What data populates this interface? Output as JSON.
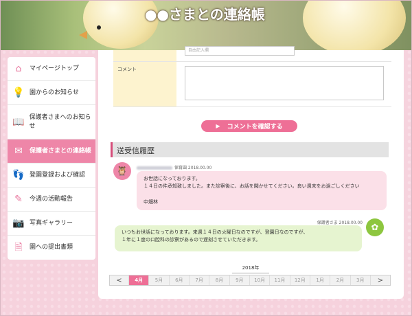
{
  "header": {
    "title": "●●さまとの連絡帳"
  },
  "sidebar": {
    "items": [
      {
        "label": "マイページトップ",
        "icon": "house-icon"
      },
      {
        "label": "園からのお知らせ",
        "icon": "lightbulb-icon"
      },
      {
        "label": "保護者さまへのお知らせ",
        "icon": "book-icon"
      },
      {
        "label": "保護者さまとの連絡帳",
        "icon": "envelope-icon",
        "active": true
      },
      {
        "label": "登園登録および確認",
        "icon": "footprints-icon"
      },
      {
        "label": "今週の活動報告",
        "icon": "pencil-icon"
      },
      {
        "label": "写真ギャラリー",
        "icon": "camera-icon"
      },
      {
        "label": "園への提出書類",
        "icon": "document-icon"
      }
    ]
  },
  "form": {
    "free_placeholder": "自由記入欄",
    "comment_label": "コメント",
    "confirm_button": "コメントを確認する"
  },
  "history": {
    "title": "送受信履歴",
    "incoming": {
      "meta": "保育園 2018.00.00",
      "lines": [
        "お世話になっております。",
        "１４日の件承知致しました。また診察後に、お話を聞かせてください。良い週末をお過ごしください",
        "",
        "中畑林"
      ]
    },
    "outgoing": {
      "meta": "保護者さま 2018.00.00",
      "lines": [
        "いつもお世話になっております。来週１４日の火曜日なのですが、登園日なのですが、",
        "１年に１度の口腔科の診察があるので遅刻させていただきます。"
      ]
    }
  },
  "calendar": {
    "year": "2018年",
    "prev": "<",
    "next": ">",
    "months": [
      "4月",
      "5月",
      "6月",
      "7月",
      "8月",
      "9月",
      "10月",
      "11月",
      "12月",
      "1月",
      "2月",
      "3月"
    ],
    "current": "4月"
  },
  "colors": {
    "accent": "#ee6f96",
    "incoming_bg": "#fbe0e8",
    "outgoing_bg": "#e6f4d0"
  }
}
